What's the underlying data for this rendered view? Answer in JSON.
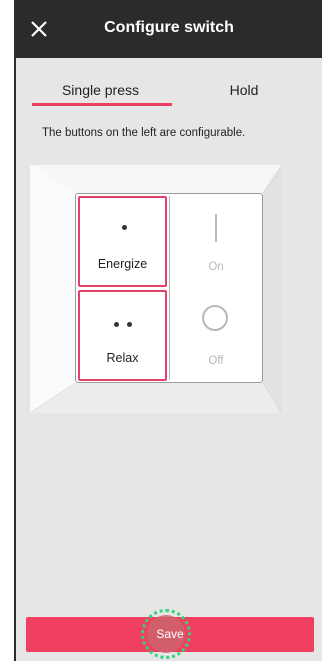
{
  "appbar": {
    "title": "Configure switch",
    "close_icon": "close-icon",
    "background": "#2b2b2b"
  },
  "tabs": [
    {
      "label": "Single press",
      "selected": true
    },
    {
      "label": "Hold",
      "selected": false
    }
  ],
  "accent_color": "#ef3f63",
  "hint": "The buttons on the left are configurable.",
  "switch": {
    "buttons": [
      {
        "label": "Energize",
        "icon": "single-dot-icon",
        "configurable": true
      },
      {
        "label": "Relax",
        "icon": "double-dot-icon",
        "configurable": true
      },
      {
        "label": "On",
        "icon": "on-bar-icon",
        "configurable": false
      },
      {
        "label": "Off",
        "icon": "off-ring-icon",
        "configurable": false
      }
    ]
  },
  "save": {
    "label": "Save"
  }
}
